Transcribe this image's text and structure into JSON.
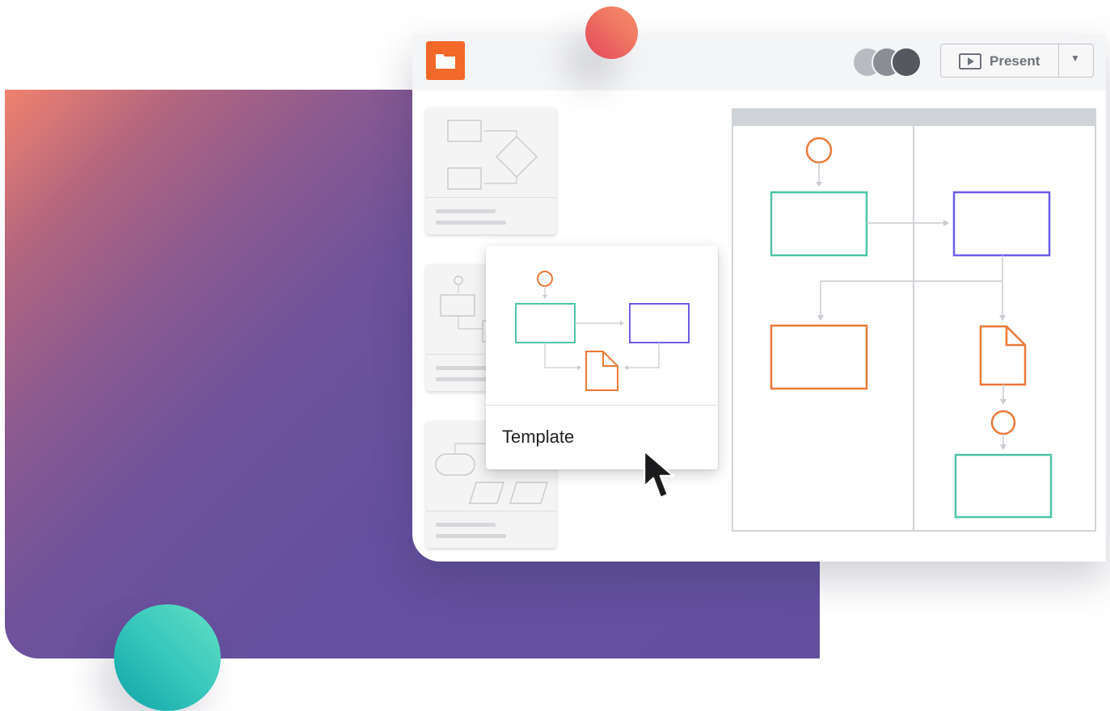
{
  "app": {
    "present_button_label": "Present",
    "template_card_label": "Template"
  },
  "icons": {
    "folder": "folder-icon",
    "present": "play-icon",
    "dropdown": "chevron-down-icon",
    "cursor": "mouse-pointer-icon"
  },
  "colors": {
    "brand_orange": "#f2692a",
    "flow_teal": "#4fc3a7",
    "flow_purple": "#6b5ce7",
    "flow_orange": "#ec7937",
    "gradient_start": "#f0826e",
    "gradient_end": "#62509f",
    "teal_circle": "#37c7bc",
    "red_circle": "#ec5a60",
    "avatars": [
      "#b8bbc0",
      "#8a8e94",
      "#55595f"
    ]
  }
}
